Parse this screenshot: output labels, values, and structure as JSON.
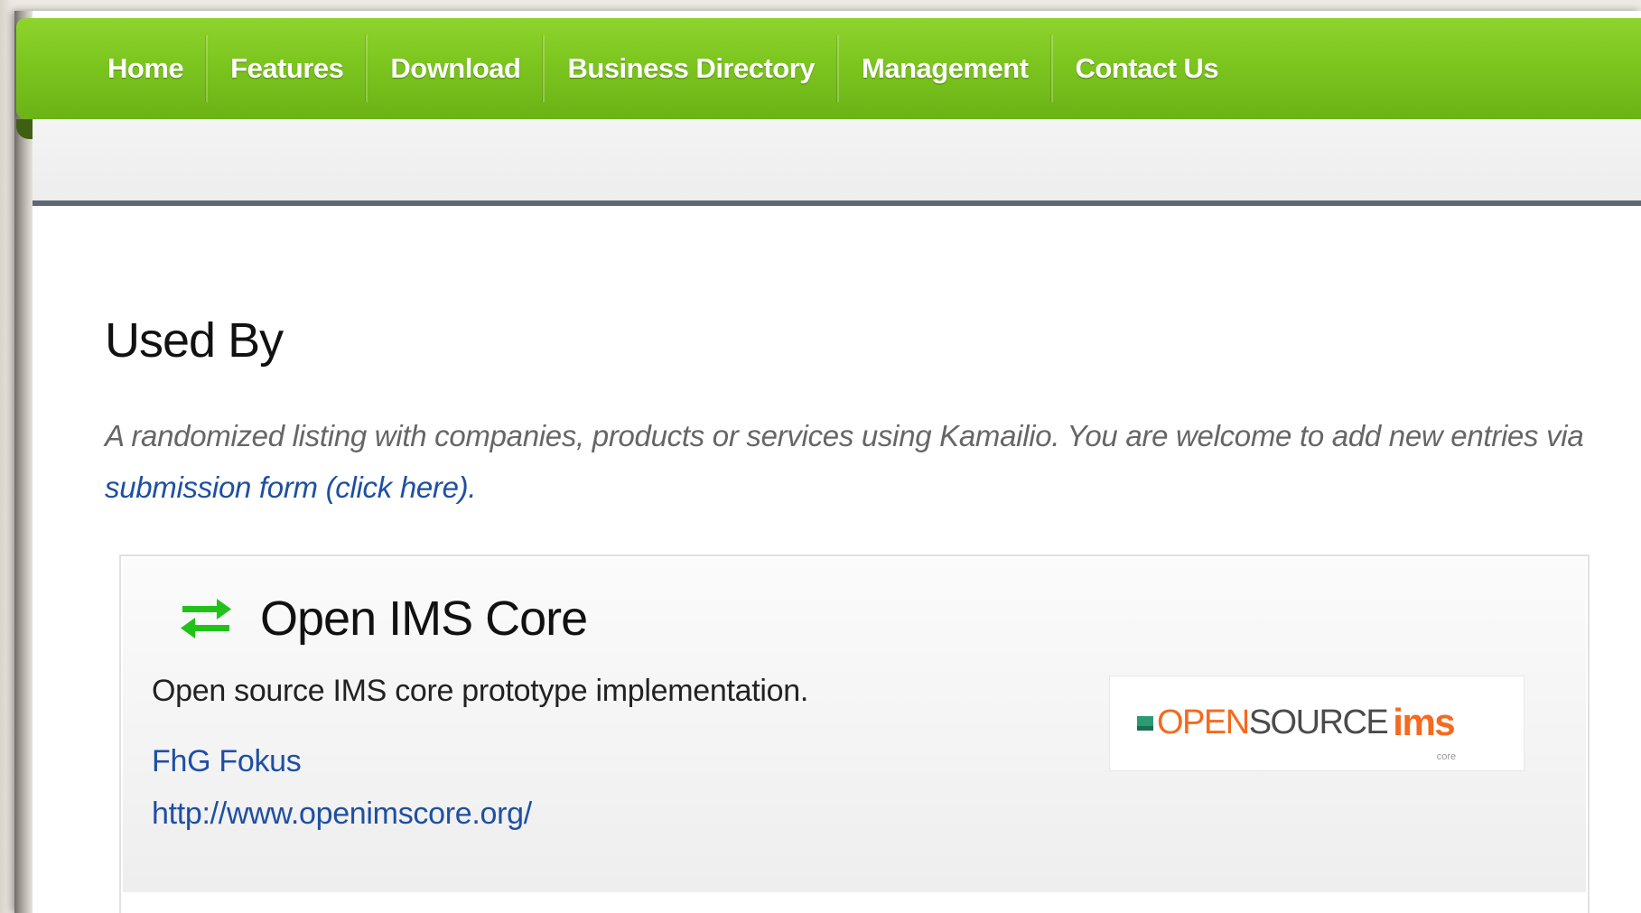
{
  "nav": {
    "items": [
      {
        "label": "Home"
      },
      {
        "label": "Features"
      },
      {
        "label": "Download"
      },
      {
        "label": "Business Directory"
      },
      {
        "label": "Management"
      },
      {
        "label": "Contact Us"
      }
    ]
  },
  "page": {
    "title": "Used By",
    "intro_text": "A randomized listing with companies, products or services using Kamailio. You are welcome to add new entries via ",
    "intro_link": "submission form (click here)",
    "intro_end": "."
  },
  "entry": {
    "title": "Open IMS Core",
    "description": "Open source IMS core prototype implementation.",
    "company": "FhG Fokus",
    "url": "http://www.openimscore.org/",
    "logo": {
      "open": "OPEN",
      "source": "SOURCE",
      "ims": "ims",
      "core": "core"
    }
  },
  "colors": {
    "nav_green": "#7cc51f",
    "link_blue": "#1f4fa3",
    "logo_orange": "#f46a1f",
    "icon_green": "#22c21a"
  },
  "icons": {
    "entry_icon": "swap-arrows-icon"
  }
}
